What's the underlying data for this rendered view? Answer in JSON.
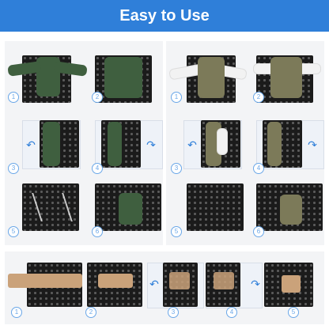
{
  "title": "Easy to Use",
  "panels": {
    "left_steps": [
      "1",
      "2",
      "3",
      "4",
      "5",
      "6"
    ],
    "right_steps": [
      "1",
      "2",
      "3",
      "4",
      "5",
      "6"
    ],
    "bottom_steps": [
      "1",
      "2",
      "3",
      "4",
      "5"
    ]
  },
  "icons": {
    "rotate_left": "rotate-left-icon",
    "rotate_right": "rotate-right-icon"
  },
  "colors": {
    "banner": "#2f7fd9",
    "panel": "#f3f4f6",
    "board": "#1b1b1b",
    "shirt_green": "#3f5f3f",
    "shirt_olive": "#7c7a59",
    "pants": "#caa27a",
    "number_accent": "#6aa7e8"
  }
}
